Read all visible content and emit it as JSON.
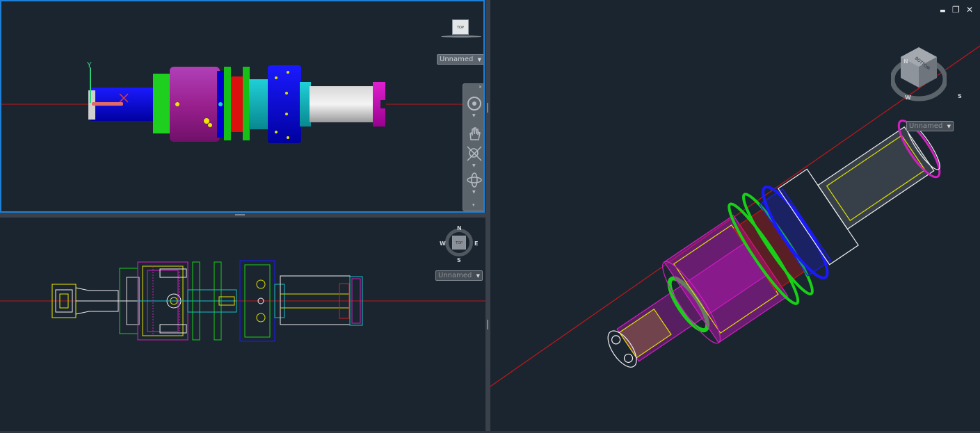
{
  "viewports": {
    "top": {
      "viewcube_face": "TOP",
      "ucs_label": "Unnamed",
      "ucs_axis_y": "Y"
    },
    "bottom": {
      "viewcube_face": "TOP",
      "ucs_label": "Unnamed",
      "compass": {
        "n": "N",
        "s": "S",
        "e": "E",
        "w": "W"
      }
    },
    "iso": {
      "ucs_label": "Unnamed",
      "viewcube_face": "BOTTOM",
      "compass": {
        "n": "N",
        "s": "S",
        "w": "W"
      }
    }
  },
  "window_controls": {
    "minimize": "▬",
    "restore": "❐",
    "close": "✕"
  },
  "navbar": {
    "tools": [
      "steering-wheel-icon",
      "pan-icon",
      "zoom-extents-icon",
      "orbit-icon"
    ]
  },
  "colors": {
    "viewport_bg": "#1b2530",
    "active_border": "#1e7fd6",
    "axis_line": "#c01818"
  }
}
